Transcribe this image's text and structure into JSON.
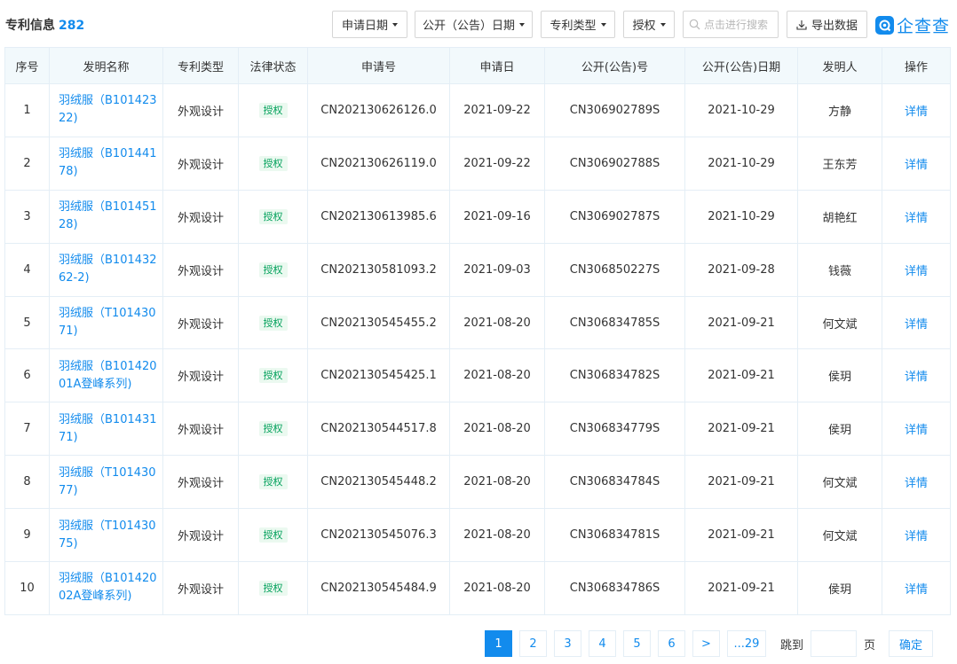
{
  "header": {
    "title": "专利信息",
    "count": "282",
    "filters": {
      "apply_date": "申请日期",
      "pub_date": "公开（公告）日期",
      "patent_type": "专利类型",
      "status": "授权"
    },
    "search_placeholder": "点击进行搜索",
    "export_label": "导出数据",
    "logo_text": "企查查"
  },
  "table": {
    "columns": {
      "index": "序号",
      "name": "发明名称",
      "type": "专利类型",
      "status": "法律状态",
      "app_no": "申请号",
      "app_date": "申请日",
      "pub_no": "公开(公告)号",
      "pub_date": "公开(公告)日期",
      "inventor": "发明人",
      "action": "操作"
    },
    "rows": [
      {
        "index": "1",
        "name": "羽绒服（B10142322)",
        "type": "外观设计",
        "status": "授权",
        "app_no": "CN202130626126.0",
        "app_date": "2021-09-22",
        "pub_no": "CN306902789S",
        "pub_date": "2021-10-29",
        "inventor": "方静",
        "action": "详情"
      },
      {
        "index": "2",
        "name": "羽绒服（B10144178)",
        "type": "外观设计",
        "status": "授权",
        "app_no": "CN202130626119.0",
        "app_date": "2021-09-22",
        "pub_no": "CN306902788S",
        "pub_date": "2021-10-29",
        "inventor": "王东芳",
        "action": "详情"
      },
      {
        "index": "3",
        "name": "羽绒服（B10145128)",
        "type": "外观设计",
        "status": "授权",
        "app_no": "CN202130613985.6",
        "app_date": "2021-09-16",
        "pub_no": "CN306902787S",
        "pub_date": "2021-10-29",
        "inventor": "胡艳红",
        "action": "详情"
      },
      {
        "index": "4",
        "name": "羽绒服（B10143262-2)",
        "type": "外观设计",
        "status": "授权",
        "app_no": "CN202130581093.2",
        "app_date": "2021-09-03",
        "pub_no": "CN306850227S",
        "pub_date": "2021-09-28",
        "inventor": "钱薇",
        "action": "详情"
      },
      {
        "index": "5",
        "name": "羽绒服（T10143071)",
        "type": "外观设计",
        "status": "授权",
        "app_no": "CN202130545455.2",
        "app_date": "2021-08-20",
        "pub_no": "CN306834785S",
        "pub_date": "2021-09-21",
        "inventor": "何文斌",
        "action": "详情"
      },
      {
        "index": "6",
        "name": "羽绒服（B10142001A登峰系列)",
        "type": "外观设计",
        "status": "授权",
        "app_no": "CN202130545425.1",
        "app_date": "2021-08-20",
        "pub_no": "CN306834782S",
        "pub_date": "2021-09-21",
        "inventor": "侯玥",
        "action": "详情"
      },
      {
        "index": "7",
        "name": "羽绒服（B10143171)",
        "type": "外观设计",
        "status": "授权",
        "app_no": "CN202130544517.8",
        "app_date": "2021-08-20",
        "pub_no": "CN306834779S",
        "pub_date": "2021-09-21",
        "inventor": "侯玥",
        "action": "详情"
      },
      {
        "index": "8",
        "name": "羽绒服（T10143077)",
        "type": "外观设计",
        "status": "授权",
        "app_no": "CN202130545448.2",
        "app_date": "2021-08-20",
        "pub_no": "CN306834784S",
        "pub_date": "2021-09-21",
        "inventor": "何文斌",
        "action": "详情"
      },
      {
        "index": "9",
        "name": "羽绒服（T10143075)",
        "type": "外观设计",
        "status": "授权",
        "app_no": "CN202130545076.3",
        "app_date": "2021-08-20",
        "pub_no": "CN306834781S",
        "pub_date": "2021-09-21",
        "inventor": "何文斌",
        "action": "详情"
      },
      {
        "index": "10",
        "name": "羽绒服（B10142002A登峰系列)",
        "type": "外观设计",
        "status": "授权",
        "app_no": "CN202130545484.9",
        "app_date": "2021-08-20",
        "pub_no": "CN306834786S",
        "pub_date": "2021-09-21",
        "inventor": "侯玥",
        "action": "详情"
      }
    ]
  },
  "pagination": {
    "pages": [
      "1",
      "2",
      "3",
      "4",
      "5",
      "6"
    ],
    "current": "1",
    "next": ">",
    "last": "...29",
    "jump_label": "跳到",
    "page_unit": "页",
    "confirm": "确定"
  },
  "colors": {
    "accent": "#128bed",
    "header_bg": "#f2f9fc",
    "border": "#e4eef6",
    "status_green": "#00a05a",
    "status_bg": "#ebf9f0"
  },
  "icons": {
    "search": "search-icon",
    "export": "download-icon",
    "logo": "qcc-logo-icon",
    "dropdown": "caret-down-icon"
  }
}
